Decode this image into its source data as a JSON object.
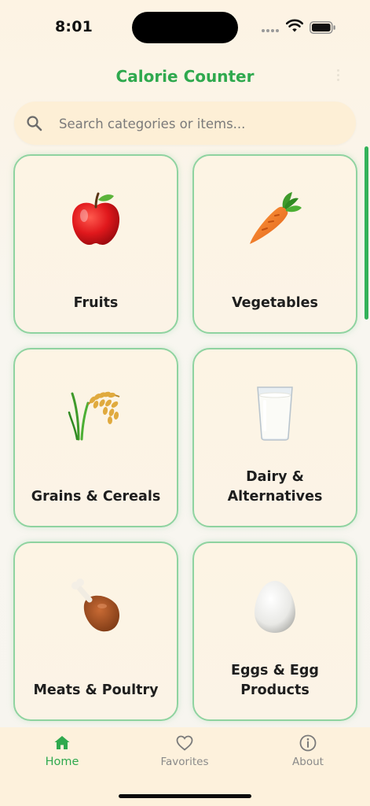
{
  "status_bar": {
    "time": "8:01"
  },
  "app_bar": {
    "title": "Calorie Counter",
    "menu_icon": "more-vertical-icon",
    "title_color": "#2fa94e"
  },
  "search": {
    "placeholder": "Search categories or items...",
    "value": "",
    "icon": "search-icon"
  },
  "categories": [
    {
      "label": "Fruits",
      "icon": "apple-icon"
    },
    {
      "label": "Vegetables",
      "icon": "carrot-icon"
    },
    {
      "label": "Grains & Cereals",
      "icon": "rice-icon"
    },
    {
      "label": "Dairy &\nAlternatives",
      "icon": "milk-glass-icon"
    },
    {
      "label": "Meats & Poultry",
      "icon": "poultry-leg-icon"
    },
    {
      "label": "Eggs & Egg\nProducts",
      "icon": "egg-icon"
    }
  ],
  "bottom_nav": {
    "items": [
      {
        "label": "Home",
        "icon": "home-icon",
        "active": true
      },
      {
        "label": "Favorites",
        "icon": "heart-icon",
        "active": false
      },
      {
        "label": "About",
        "icon": "info-icon",
        "active": false
      }
    ]
  },
  "colors": {
    "accent": "#2fa94e",
    "card_border": "#8fd3a0",
    "card_background": "#fdf4e4",
    "search_background": "#fdefd6",
    "nav_background": "#fdf1dc"
  }
}
